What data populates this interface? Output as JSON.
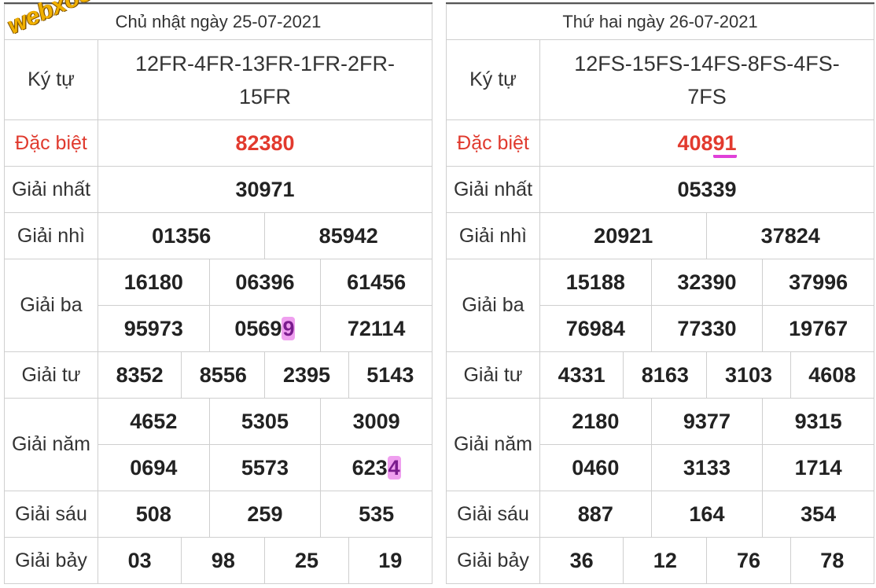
{
  "watermark": "webxoso.net",
  "panels": [
    {
      "date_title": "Chủ nhật ngày 25-07-2021",
      "labels": {
        "ky_tu": "Ký tự",
        "dac_biet": "Đặc biệt",
        "nhat": "Giải nhất",
        "nhi": "Giải nhì",
        "ba": "Giải ba",
        "tu": "Giải tư",
        "nam": "Giải năm",
        "sau": "Giải sáu",
        "bay": "Giải bảy"
      },
      "ky_tu_line1": "12FR-4FR-13FR-1FR-2FR-",
      "ky_tu_line2": "15FR",
      "dac_biet": "82380",
      "nhat": "30971",
      "nhi": [
        "01356",
        "85942"
      ],
      "ba": [
        "16180",
        "06396",
        "61456",
        "95973",
        "0569",
        "9",
        "72114"
      ],
      "tu": [
        "8352",
        "8556",
        "2395",
        "5143"
      ],
      "nam": [
        "4652",
        "5305",
        "3009",
        "0694",
        "5573",
        "623",
        "4"
      ],
      "sau": [
        "508",
        "259",
        "535"
      ],
      "bay": [
        "03",
        "98",
        "25",
        "19"
      ]
    },
    {
      "date_title": "Thứ hai ngày 26-07-2021",
      "labels": {
        "ky_tu": "Ký tự",
        "dac_biet": "Đặc biệt",
        "nhat": "Giải nhất",
        "nhi": "Giải nhì",
        "ba": "Giải ba",
        "tu": "Giải tư",
        "nam": "Giải năm",
        "sau": "Giải sáu",
        "bay": "Giải bảy"
      },
      "ky_tu_line1": "12FS-15FS-14FS-8FS-4FS-",
      "ky_tu_line2": "7FS",
      "dac_biet_prefix": "408",
      "dac_biet_suffix": "91",
      "nhat": "05339",
      "nhi": [
        "20921",
        "37824"
      ],
      "ba": [
        "15188",
        "32390",
        "37996",
        "76984",
        "77330",
        "19767"
      ],
      "tu": [
        "4331",
        "8163",
        "3103",
        "4608"
      ],
      "nam": [
        "2180",
        "9377",
        "9315",
        "0460",
        "3133",
        "1714"
      ],
      "sau": [
        "887",
        "164",
        "354"
      ],
      "bay": [
        "36",
        "12",
        "76",
        "78"
      ]
    }
  ]
}
